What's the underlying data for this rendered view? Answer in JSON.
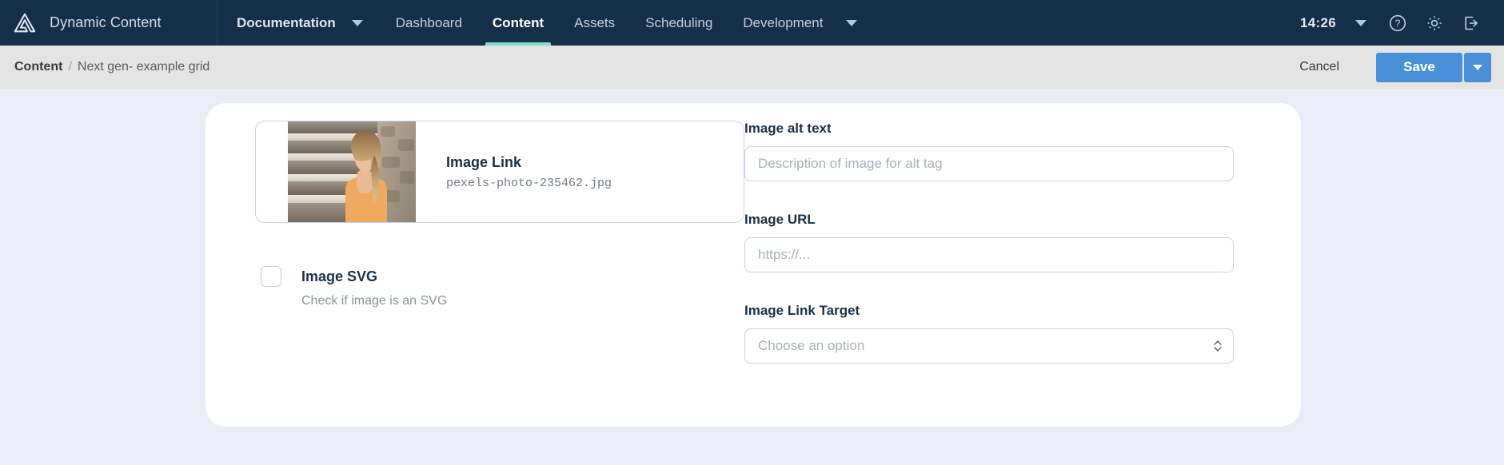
{
  "topnav": {
    "brand": "Dynamic Content",
    "brand_icon": "amplience-triangle-logo",
    "menu_label": "Documentation",
    "menu_caret_icon": "caret-down-icon",
    "tabs": [
      {
        "label": "Dashboard",
        "active": false
      },
      {
        "label": "Content",
        "active": true
      },
      {
        "label": "Assets",
        "active": false
      },
      {
        "label": "Scheduling",
        "active": false
      },
      {
        "label": "Development",
        "active": false
      }
    ],
    "development_caret_icon": "caret-down-icon",
    "clock": "14:26",
    "clock_caret_icon": "caret-down-icon",
    "help_icon": "question-circle-icon",
    "settings_icon": "gear-icon",
    "logout_icon": "sign-out-icon",
    "accent_color": "#7fe0c8",
    "background_color": "#143049"
  },
  "subbar": {
    "breadcrumb_root": "Content",
    "breadcrumb_separator": "/",
    "breadcrumb_current": "Next gen- example grid",
    "cancel_label": "Cancel",
    "save_label": "Save",
    "save_caret_icon": "caret-down-icon",
    "save_color": "#4a90d9"
  },
  "form": {
    "asset": {
      "title": "Image Link",
      "filename": "pexels-photo-235462.jpg",
      "thumbnail_alt": "woman-on-stone-steps-photo"
    },
    "svg_checkbox": {
      "label": "Image SVG",
      "help": "Check if image is an SVG",
      "checked": false
    },
    "alt_text": {
      "label": "Image alt text",
      "placeholder": "Description of image for alt tag",
      "value": ""
    },
    "image_url": {
      "label": "Image URL",
      "placeholder": "https://...",
      "value": ""
    },
    "link_target": {
      "label": "Image Link Target",
      "placeholder": "Choose an option",
      "value": "",
      "stepper_icon": "chevron-updown-icon"
    }
  },
  "theme": {
    "page_background": "#eaedf7",
    "card_background": "#ffffff",
    "field_border": "#c9d1ee"
  }
}
